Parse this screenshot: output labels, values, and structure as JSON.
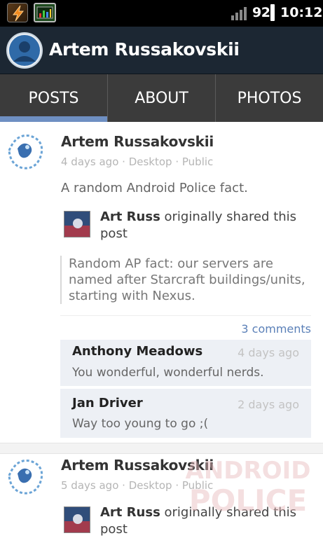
{
  "status_bar": {
    "battery": "92",
    "time": "10:12"
  },
  "action_bar": {
    "title": "Artem Russakovskii"
  },
  "tabs": [
    {
      "label": "POSTS",
      "selected": true
    },
    {
      "label": "ABOUT",
      "selected": false
    },
    {
      "label": "PHOTOS",
      "selected": false
    }
  ],
  "posts": [
    {
      "author": "Artem Russakovskii",
      "time": "4 days ago",
      "source": "Desktop",
      "visibility": "Public",
      "text": "A random Android Police fact.",
      "shared_from": "Art Russ",
      "shared_suffix": " originally shared this",
      "shared_suffix2": "post",
      "quote_lines": [
        "Random AP fact: our servers are",
        "named after Starcraft buildings/units,",
        "starting with Nexus."
      ],
      "comments_count": "3 comments",
      "comments": [
        {
          "name": "Anthony Meadows",
          "time": "4 days ago",
          "text": "You wonderful, wonderful nerds."
        },
        {
          "name": "Jan Driver",
          "time": "2 days ago",
          "text": "Way too young to go ;("
        }
      ]
    },
    {
      "author": "Artem Russakovskii",
      "time": "5 days ago",
      "source": "Desktop",
      "visibility": "Public",
      "shared_from": "Art Russ",
      "shared_suffix": " originally shared this",
      "shared_suffix2": "post"
    }
  ],
  "meta_separator": " · ",
  "watermark": {
    "line1": "ANDROID",
    "line2": "POLICE"
  },
  "colors": {
    "action_bar": "#1c2733",
    "tabs": "#3b3b3b",
    "tab_indicator": "#6e8fc2",
    "comments_link": "#5b80b8",
    "comment_bg": "#edf0f5"
  },
  "icons": [
    "app-icon-flash",
    "app-icon-monitor",
    "signal-icon",
    "battery-icon",
    "profile-avatar-icon"
  ]
}
